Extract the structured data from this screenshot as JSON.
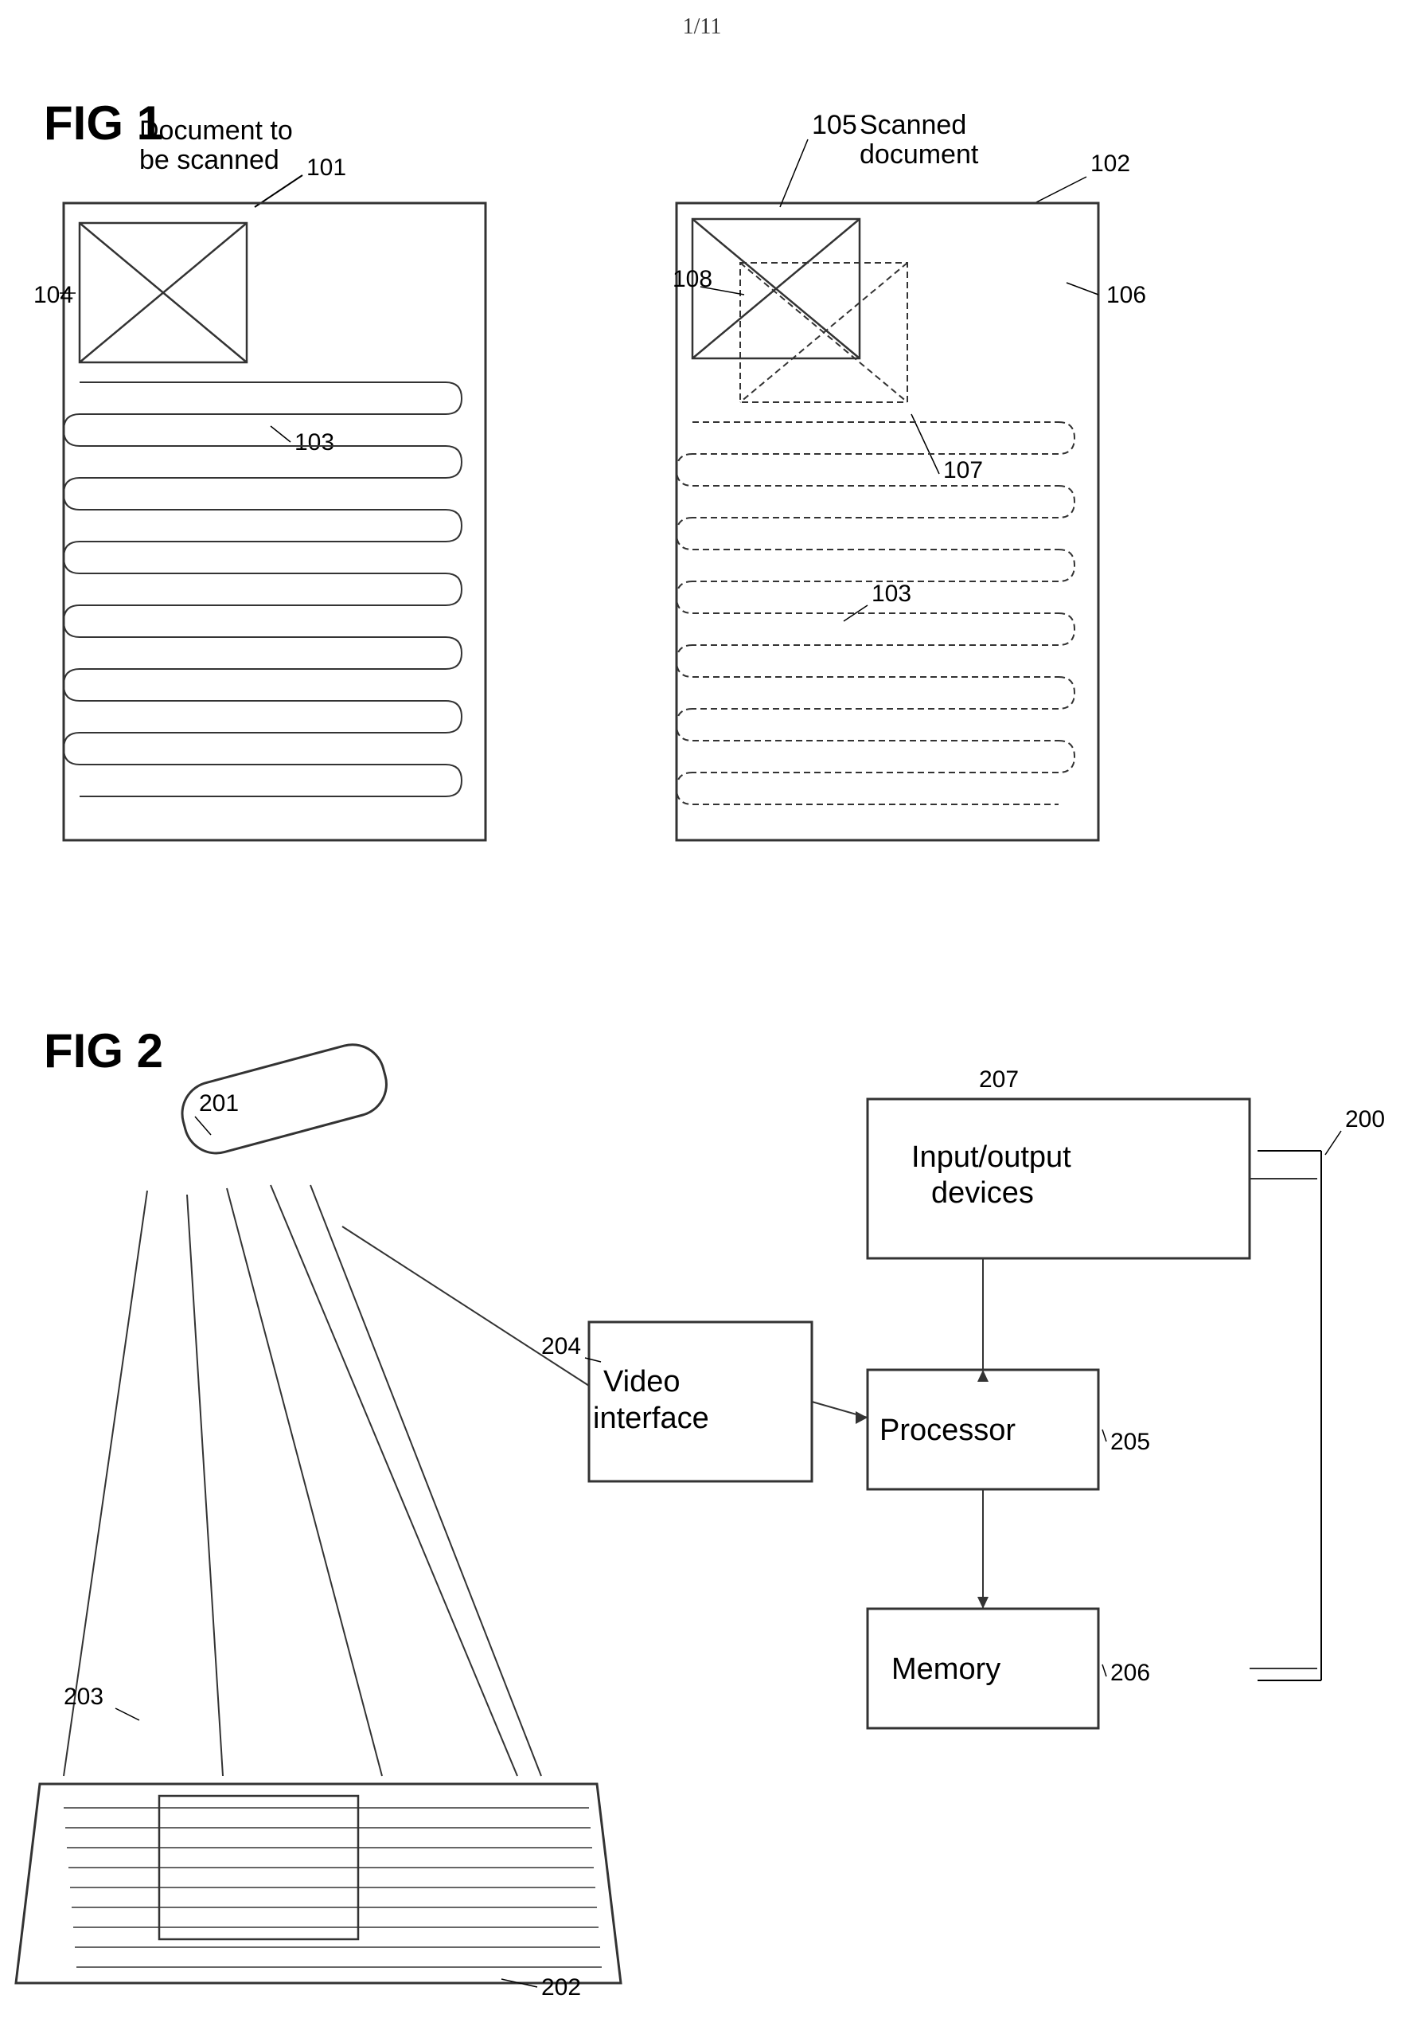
{
  "page": {
    "number": "1/11",
    "background": "#ffffff"
  },
  "fig1": {
    "label": "FIG 1",
    "left_doc": {
      "title": "Document to\nbe scanned",
      "ref": "101",
      "image_ref": "104",
      "scan_path_ref": "103"
    },
    "right_doc": {
      "title": "Scanned\ndocument",
      "ref": "102",
      "image_ref": "105",
      "overlay_ref": "106",
      "distorted_ref": "107",
      "combined_ref": "108",
      "scan_path_ref": "103"
    }
  },
  "fig2": {
    "label": "FIG 2",
    "system_ref": "200",
    "scanner_ref": "201",
    "document_ref": "202",
    "scanner_beam_ref": "203",
    "video_interface": {
      "label": "Video\ninterface",
      "ref": "204"
    },
    "processor": {
      "label": "Processor",
      "ref": "205"
    },
    "memory": {
      "label": "Memory",
      "ref": "206"
    },
    "io_devices": {
      "label": "Input/output\ndevices",
      "ref": "207"
    }
  }
}
